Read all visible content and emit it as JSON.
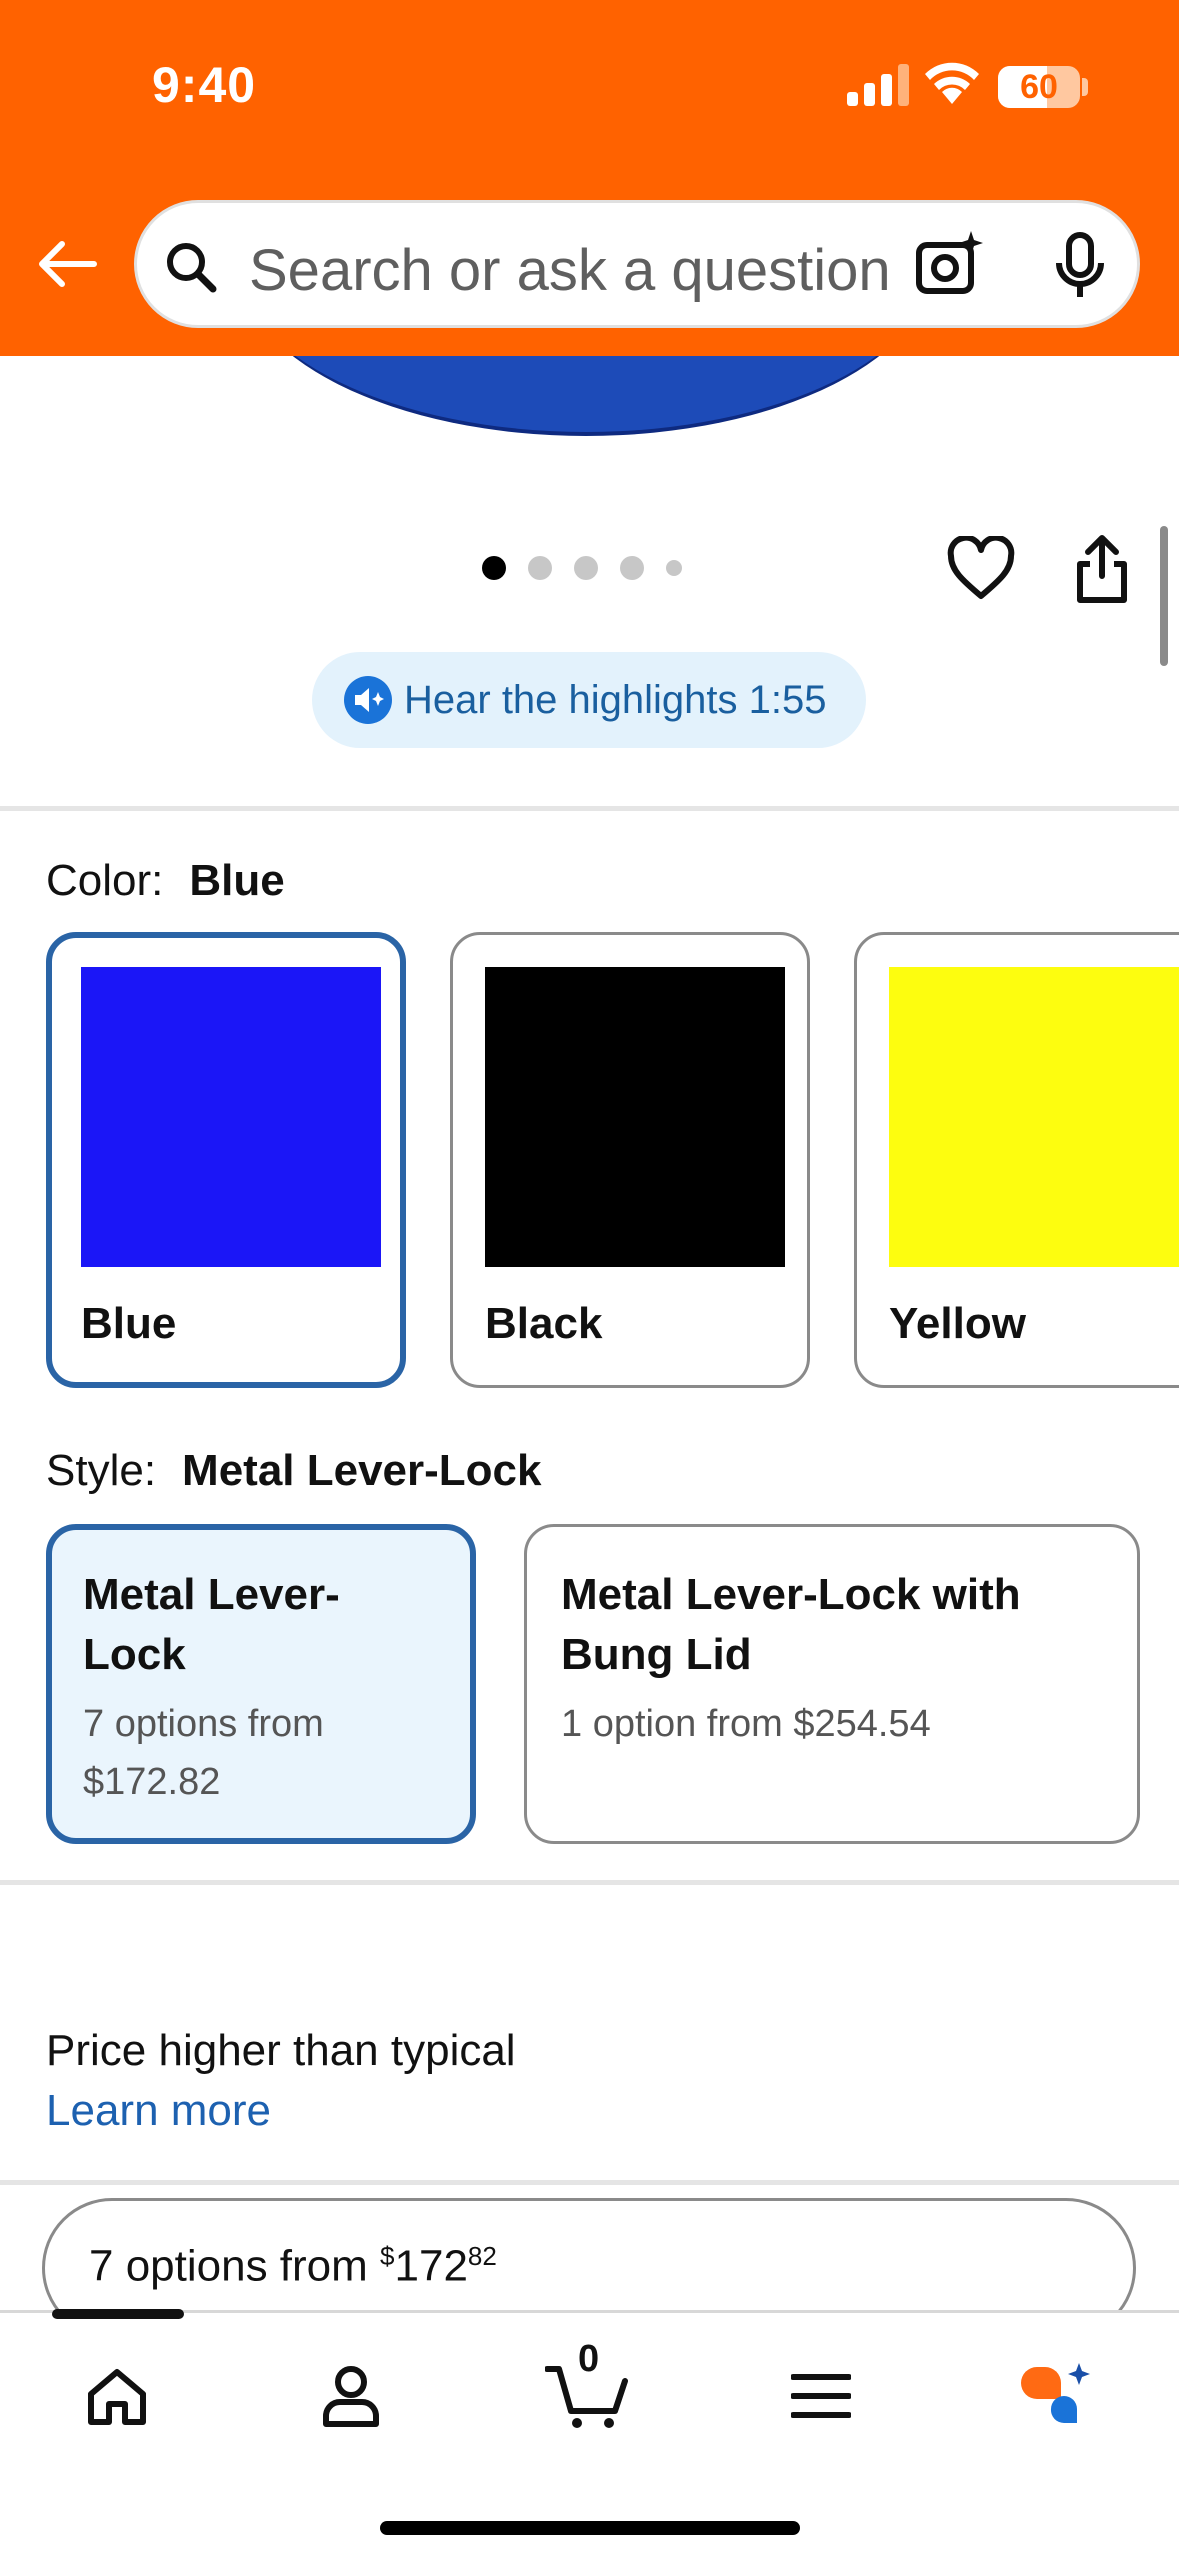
{
  "status_bar": {
    "time": "9:40",
    "battery": "60",
    "battery_level": 0.6
  },
  "header": {
    "background_color": "#ff6200",
    "back_icon": "arrow-left-icon",
    "search_placeholder": "Search or ask a question",
    "camera_icon": "camera-sparkle-icon",
    "mic_icon": "microphone-icon"
  },
  "gallery": {
    "dot_count": 5,
    "active_index": 0,
    "favorite_icon": "heart-icon",
    "share_icon": "share-icon"
  },
  "highlights": {
    "label": "Hear the highlights 1:55",
    "icon": "speaker-sparkle-icon"
  },
  "color": {
    "label": "Color:",
    "selected": "Blue",
    "options": [
      {
        "name": "Blue",
        "hex": "#1b16f7"
      },
      {
        "name": "Black",
        "hex": "#000000"
      },
      {
        "name": "Yellow",
        "hex": "#fdfd0f"
      }
    ]
  },
  "style": {
    "label": "Style:",
    "selected": "Metal Lever-Lock",
    "options": [
      {
        "title": "Metal Lever-Lock",
        "sub": "7 options from $172.82"
      },
      {
        "title": "Metal Lever-Lock with Bung Lid",
        "sub": "1 option from $254.54"
      }
    ]
  },
  "price_note": {
    "text": "Price higher than typical",
    "link": "Learn more"
  },
  "options_button": {
    "prefix": "7 options from ",
    "currency": "$",
    "dollars": "172",
    "cents": "82"
  },
  "tab_bar": {
    "items": [
      "home-icon",
      "account-icon",
      "cart-icon",
      "menu-icon",
      "assistant-sparkle-icon"
    ],
    "cart_count": "0"
  },
  "accent_color": "#2a64a6"
}
